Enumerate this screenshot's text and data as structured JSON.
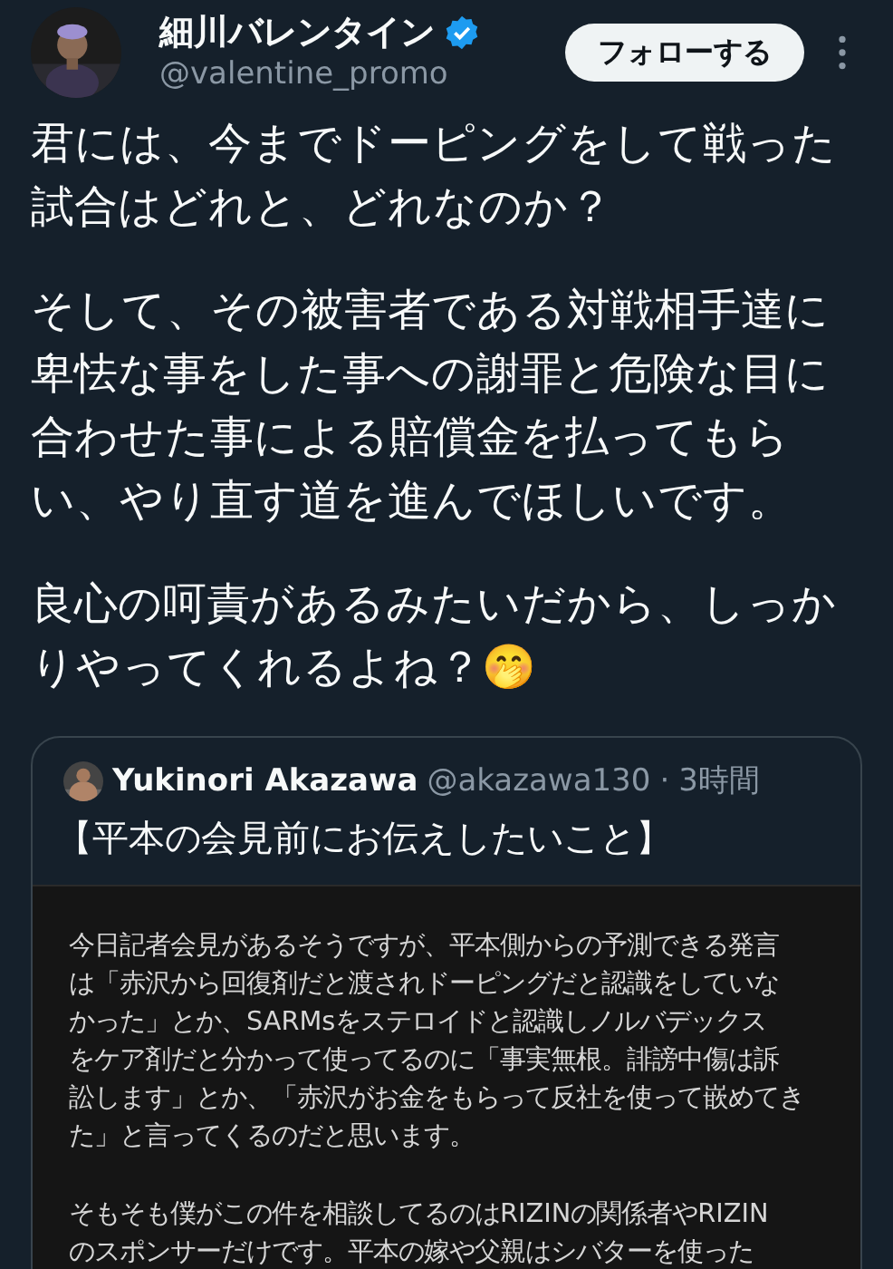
{
  "author": {
    "name": "細川バレンタイン",
    "handle": "@valentine_promo",
    "verified": true
  },
  "follow_button": "フォローする",
  "tweet": {
    "paragraphs": [
      [
        "君には、今までドーピングをして戦った",
        "試合はどれと、どれなのか？"
      ],
      [
        "そして、その被害者である対戦相手達に",
        "卑怯な事をした事への謝罪と危険な目に",
        "合わせた事による賠償金を払ってもら",
        "い、やり直す道を進んでほしいです。"
      ],
      [
        "良心の呵責があるみたいだから、しっか",
        "りやってくれるよね？🤭"
      ]
    ]
  },
  "quote": {
    "author": {
      "name": "Yukinori Akazawa",
      "handle": "@akazawa130",
      "separator": "·",
      "time": "3時間"
    },
    "title": "【平本の会見前にお伝えしたいこと】",
    "screenshot": {
      "paragraphs": [
        [
          "今日記者会見があるそうですが、平本側からの予測できる発言",
          "は「赤沢から回復剤だと渡されドーピングだと認識をしていな",
          "かった」とか、SARMsをステロイドと認識しノルバデックス",
          "をケア剤だと分かって使ってるのに「事実無根。誹謗中傷は訴",
          "訟します」とか、「赤沢がお金をもらって反社を使って嵌めてき",
          "た」と言ってくるのだと思います。"
        ],
        [
          "そもそも僕がこの件を相談してるのはRIZINの関係者やRIZIN",
          "のスポンサーだけです。平本の嫁や父親はシバターを使った"
        ]
      ]
    }
  }
}
